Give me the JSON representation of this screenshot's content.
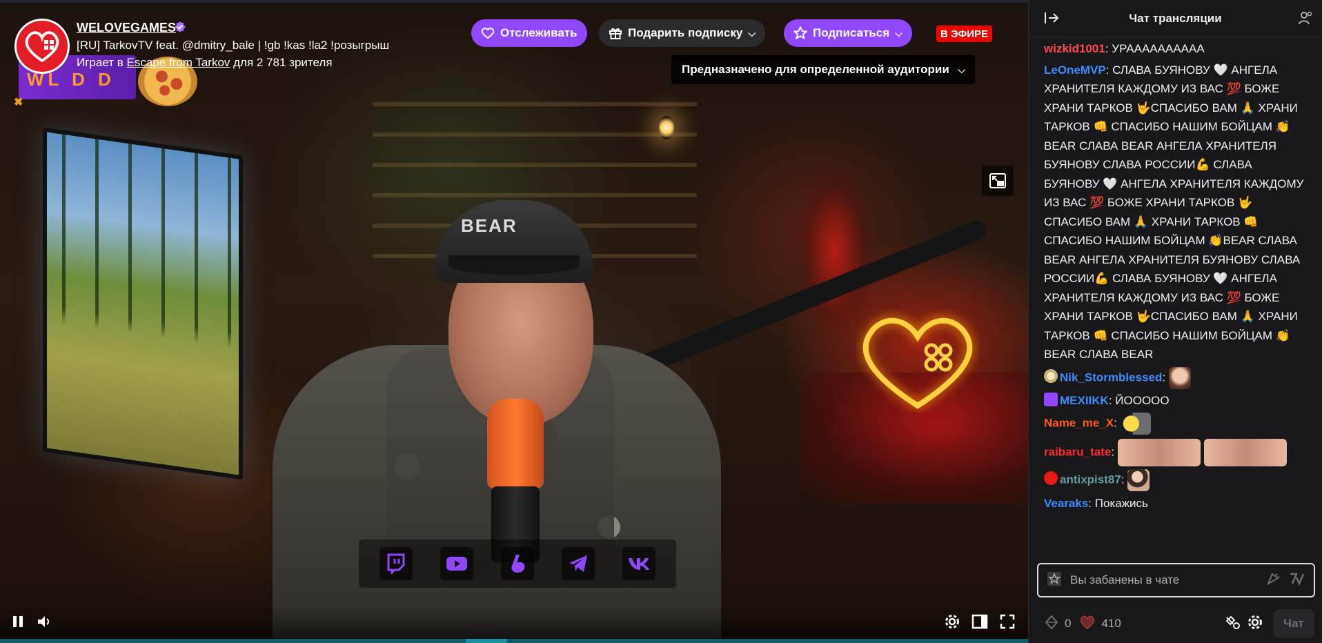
{
  "channel": {
    "name": "WELOVEGAMES",
    "title": "[RU] TarkovTV feat. @dmitry_bale | !gb !kas !la2 !розыгрыш",
    "playing_prefix": "Играет в ",
    "game": "Escape from Tarkov",
    "viewers_prefix": " для ",
    "viewers": "2 781",
    "viewers_suffix": " зрителя"
  },
  "sponsor": {
    "text": "WL  D  D"
  },
  "actions": {
    "follow_label": "Отслеживать",
    "gift_label": "Подарить подписку",
    "subscribe_label": "Подписаться",
    "live_label": "В ЭФИРЕ",
    "audience_label": "Предназначено для определенной аудитории"
  },
  "socials": [
    "twitch-icon",
    "youtube-icon",
    "boosty-icon",
    "telegram-icon",
    "vk-icon"
  ],
  "colors": {
    "accent": "#9147ff",
    "live": "#eb0400",
    "chat_bg": "#18181b"
  },
  "chat": {
    "title": "Чат трансляции",
    "messages": [
      {
        "user": "wizkid1001",
        "color": "#ff4d4d",
        "text": "УРАААААААААА"
      },
      {
        "user": "LeOneMVP",
        "color": "#3d8bff",
        "text": "СЛАВА БУЯНОВУ 🤍 АНГЕЛА ХРАНИТЕЛЯ КАЖДОМУ ИЗ ВАС 💯 БОЖЕ ХРАНИ ТАРКОВ 🤟СПАСИБО ВАМ 🙏 ХРАНИ ТАРКОВ 👊 СПАСИБО НАШИМ БОЙЦАМ 👏BEAR СЛАВА BEAR АНГЕЛА ХРАНИТЕЛЯ БУЯНОВУ СЛАВА РОССИИ💪 СЛАВА БУЯНОВУ 🤍 АНГЕЛА ХРАНИТЕЛЯ КАЖДОМУ ИЗ ВАС 💯 БОЖЕ ХРАНИ ТАРКОВ 🤟СПАСИБО ВАМ 🙏 ХРАНИ ТАРКОВ 👊 СПАСИБО НАШИМ БОЙЦАМ 👏BEAR СЛАВА BEAR АНГЕЛА ХРАНИТЕЛЯ БУЯНОВУ СЛАВА РОССИИ💪 СЛАВА БУЯНОВУ 🤍 АНГЕЛА ХРАНИТЕЛЯ КАЖДОМУ ИЗ ВАС 💯 БОЖЕ ХРАНИ ТАРКОВ 🤟СПАСИБО ВАМ 🙏 ХРАНИ ТАРКОВ 👊 СПАСИБО НАШИМ БОЙЦАМ 👏BEAR СЛАВА BEAR"
      },
      {
        "user": "Nik_Stormblessed",
        "color": "#3d8bff",
        "text": ""
      },
      {
        "user": "MEXIIKK",
        "color": "#3d8bff",
        "text": "ЙОООOO"
      },
      {
        "user": "Name_me_X",
        "color": "#ff5a1f",
        "text": ""
      },
      {
        "user": "raibaru_tate",
        "color": "#ff2a2a",
        "text": ""
      },
      {
        "user": "antixpist87",
        "color": "#5f9ea0",
        "text": ""
      },
      {
        "user": "Vearaks",
        "color": "#3d8bff",
        "text": "Покажись"
      }
    ],
    "input_placeholder": "Вы забанены в чате",
    "points_a": "0",
    "points_b": "410",
    "chat_button": "Чат"
  }
}
